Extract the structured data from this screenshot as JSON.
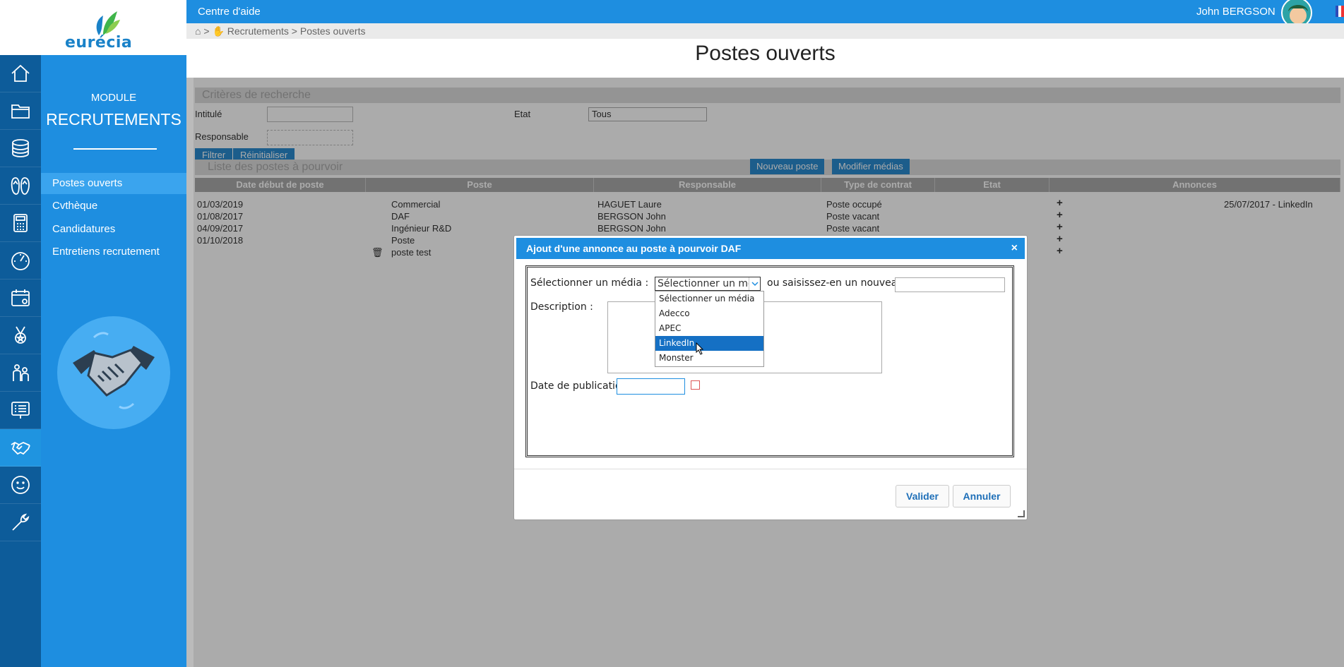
{
  "brand": {
    "logo_text": "eurécia"
  },
  "topbar": {
    "help": "Centre d'aide",
    "user": "John  BERGSON"
  },
  "breadcrumb": {
    "path": "Recrutements > Postes ouverts"
  },
  "page": {
    "title": "Postes ouverts"
  },
  "module": {
    "small": "MODULE",
    "big": "RECRUTEMENTS",
    "items": [
      {
        "label": "Postes ouverts"
      },
      {
        "label": "Cvthèque"
      },
      {
        "label": "Candidatures"
      },
      {
        "label": "Entretiens recrutement"
      }
    ]
  },
  "rail": {
    "icons": [
      "home-icon",
      "folder-icon",
      "coins-icon",
      "flipflops-icon",
      "calculator-icon",
      "gauge-icon",
      "calendar-icon",
      "medal-icon",
      "people-icon",
      "presentation-icon",
      "handshake-icon",
      "smiley-icon",
      "wrench-icon"
    ]
  },
  "search": {
    "header": "Critères de recherche",
    "intitule_label": "Intitulé",
    "etat_label": "Etat",
    "etat_value": "Tous",
    "responsable_label": "Responsable",
    "filter_btn": "Filtrer",
    "reset_btn": "Réinitialiser"
  },
  "list": {
    "header": "Liste des postes à pourvoir",
    "new_btn": "Nouveau poste",
    "media_btn": "Modifier médias",
    "columns": [
      "Date début de poste",
      "Poste",
      "Responsable",
      "Type de contrat",
      "Etat",
      "Annonces"
    ],
    "rows": [
      {
        "date": "01/03/2019",
        "poste": "Commercial",
        "resp": "HAGUET Laure",
        "type": "Poste occupé",
        "annonce": "25/07/2017 - LinkedIn"
      },
      {
        "date": "01/08/2017",
        "poste": "DAF",
        "resp": "BERGSON John",
        "type": "Poste vacant",
        "annonce": ""
      },
      {
        "date": "04/09/2017",
        "poste": "Ingénieur R&D",
        "resp": "BERGSON John",
        "type": "Poste vacant",
        "annonce": ""
      },
      {
        "date": "01/10/2018",
        "poste": "Poste",
        "resp": "",
        "type": "",
        "annonce": ""
      },
      {
        "date": "",
        "poste": "poste test",
        "resp": "",
        "type": "",
        "annonce": ""
      }
    ]
  },
  "dialog": {
    "title": "Ajout d'une annonce au poste à pourvoir DAF",
    "close": "×",
    "media_label": "Sélectionner un média :",
    "media_value": "Sélectionner un média",
    "new_label": "ou saisissez-en un nouveau :",
    "desc_label": "Description :",
    "date_label": "Date de publication :",
    "options": [
      "Sélectionner un média",
      "Adecco",
      "APEC",
      "LinkedIn",
      "Monster"
    ],
    "highlighted": "LinkedIn",
    "validate": "Valider",
    "cancel": "Annuler"
  }
}
